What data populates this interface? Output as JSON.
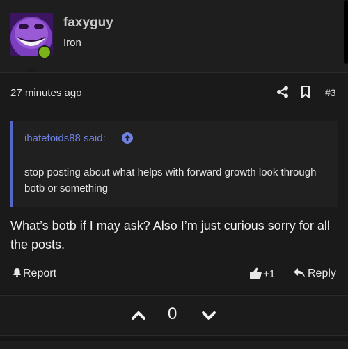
{
  "author": {
    "username": "faxyguy",
    "title": "Iron",
    "avatar_icon": "purple-grinning-face-avatar",
    "status_color": "#7bb31a"
  },
  "post": {
    "time": "27 minutes ago",
    "number": "#3",
    "share_icon": "share-icon",
    "bookmark_icon": "bookmark-icon"
  },
  "quote": {
    "attribution": "ihatefoids88 said:",
    "text": "stop posting about what helps with forward growth look through botb or something",
    "accent_color": "#6f82e0"
  },
  "message": "What’s botb if I may ask? Also I’m just curious sorry for all the posts.",
  "actions": {
    "report_label": "Report",
    "like_count": "+1",
    "reply_label": "Reply"
  },
  "vote": {
    "score": "0"
  }
}
